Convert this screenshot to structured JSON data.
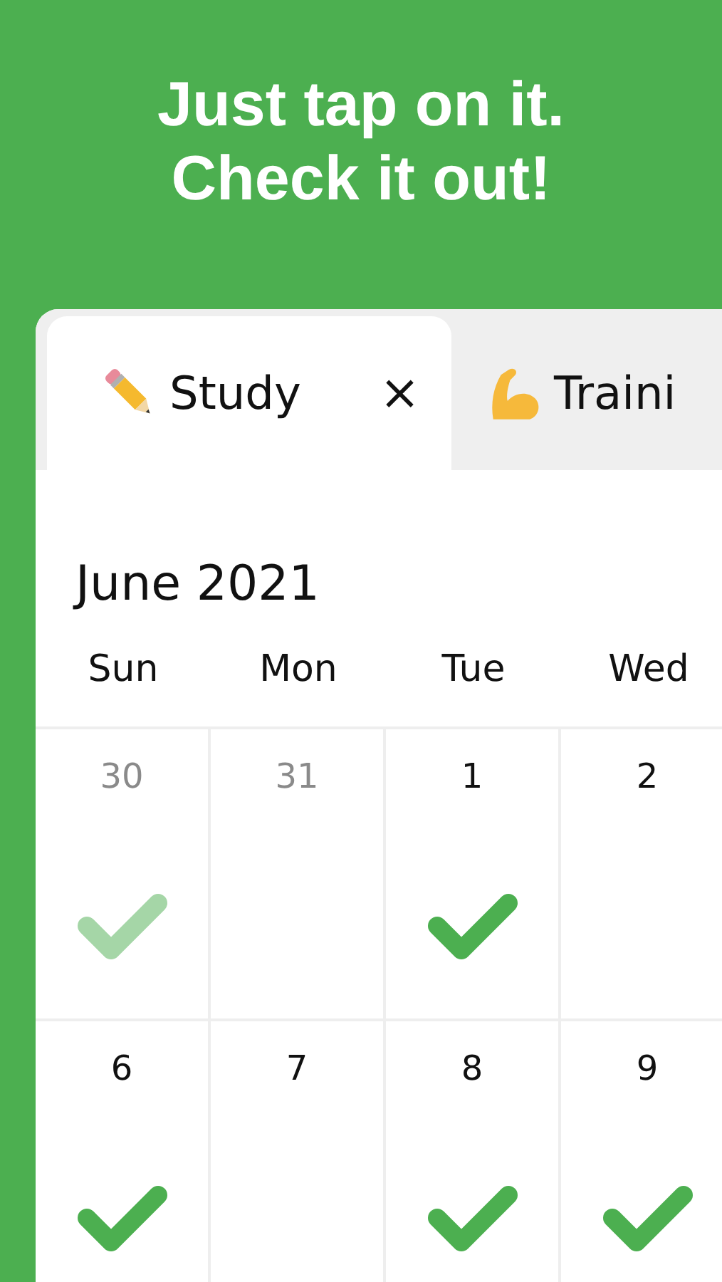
{
  "headline": [
    "Just tap on it.",
    "Check it out!"
  ],
  "tabs": [
    {
      "label": "Study",
      "selected": true,
      "closable": true
    },
    {
      "label": "Traini",
      "selected": false,
      "closable": false
    }
  ],
  "close_symbol": "×",
  "month": "June 2021",
  "weekdays": [
    "Sun",
    "Mon",
    "Tue",
    "Wed"
  ],
  "weeks": [
    [
      {
        "day": "30",
        "muted": true,
        "checked": true
      },
      {
        "day": "31",
        "muted": true,
        "checked": false
      },
      {
        "day": "1",
        "muted": false,
        "checked": true
      },
      {
        "day": "2",
        "muted": false,
        "checked": false
      }
    ],
    [
      {
        "day": "6",
        "muted": false,
        "checked": true
      },
      {
        "day": "7",
        "muted": false,
        "checked": false
      },
      {
        "day": "8",
        "muted": false,
        "checked": true
      },
      {
        "day": "9",
        "muted": false,
        "checked": true
      }
    ]
  ]
}
